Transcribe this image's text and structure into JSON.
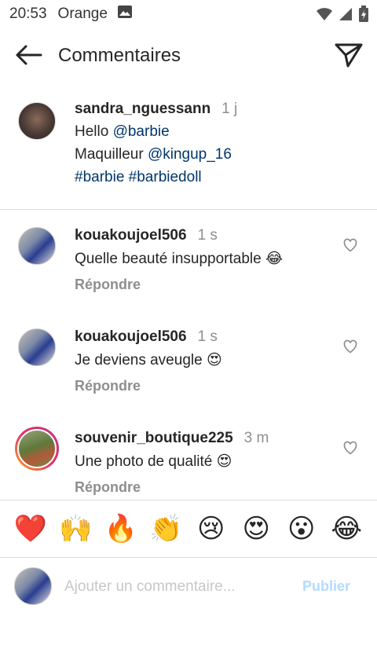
{
  "status_bar": {
    "time": "20:53",
    "carrier": "Orange"
  },
  "header": {
    "title": "Commentaires"
  },
  "caption": {
    "username": "sandra_nguessann",
    "time": "1 j",
    "line1_prefix": "Hello ",
    "line1_mention": "@barbie",
    "line2_prefix": "Maquilleur ",
    "line2_mention": "@kingup_16",
    "hashtag1": "#barbie",
    "hashtag2": "#barbiedoll"
  },
  "comments": [
    {
      "username": "kouakoujoel506",
      "time": "1 s",
      "text": "Quelle beauté insupportable",
      "emoji": "😂",
      "reply": "Répondre"
    },
    {
      "username": "kouakoujoel506",
      "time": "1 s",
      "text": "Je deviens aveugle",
      "emoji": "😍",
      "reply": "Répondre"
    },
    {
      "username": "souvenir_boutique225",
      "time": "3 m",
      "text": "Une photo de qualité",
      "emoji": "😍",
      "reply": "Répondre"
    }
  ],
  "emoji_bar": [
    "❤️",
    "🙌",
    "🔥",
    "👏",
    "😢",
    "😍",
    "😮",
    "😂"
  ],
  "composer": {
    "placeholder": "Ajouter un commentaire...",
    "publish_label": "Publier"
  },
  "colors": {
    "link": "#00376b",
    "muted": "#8e8e8e",
    "publish_disabled": "#b3dbff",
    "divider": "#dbdbdb"
  }
}
